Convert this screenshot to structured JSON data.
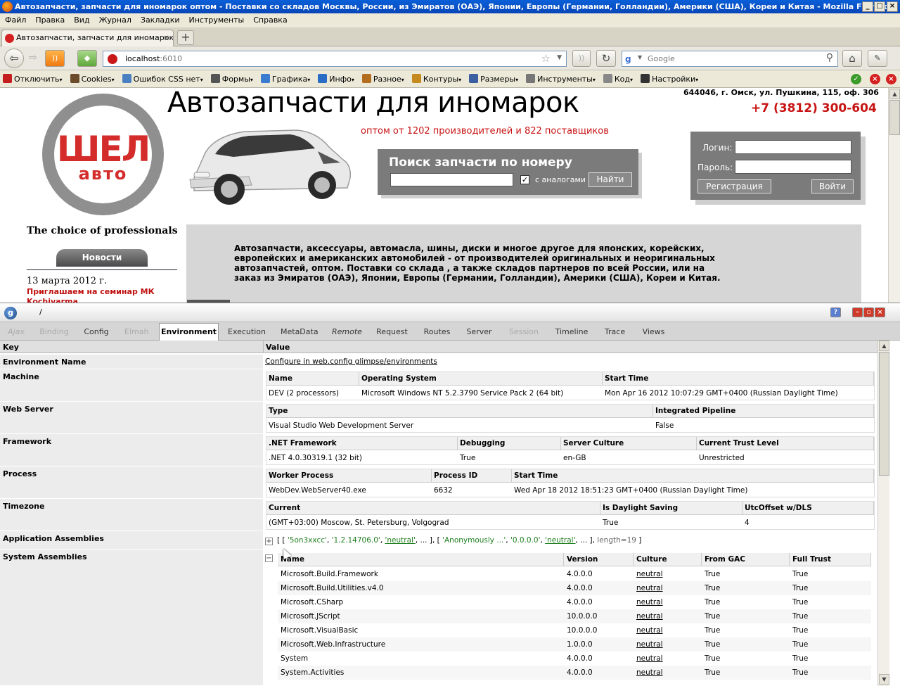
{
  "window": {
    "title": "Автозапчасти, запчасти для иномарок оптом - Поставки со складов Москвы, России, из Эмиратов (ОАЭ), Японии, Европы (Германии, Голландии), Америки (США), Кореи и Китая - Mozilla Firefox"
  },
  "menu": [
    "Файл",
    "Правка",
    "Вид",
    "Журнал",
    "Закладки",
    "Инструменты",
    "Справка"
  ],
  "tab": {
    "title": "Автозапчасти, запчасти для иномарок оп...",
    "close": "×",
    "new": "+"
  },
  "nav": {
    "url_host": "localhost",
    "url_port": ":6010",
    "search_placeholder": "Google"
  },
  "devbar": [
    {
      "label": "Отключить",
      "color": "#c41e1e"
    },
    {
      "label": "Cookies",
      "color": "#6b4b2a"
    },
    {
      "label": "Ошибок CSS нет",
      "color": "#4a7fc1"
    },
    {
      "label": "Формы",
      "color": "#555555"
    },
    {
      "label": "Графика",
      "color": "#3b7bd0"
    },
    {
      "label": "Инфо",
      "color": "#2b6cc4"
    },
    {
      "label": "Разное",
      "color": "#b36d1e"
    },
    {
      "label": "Контуры",
      "color": "#c48a1e"
    },
    {
      "label": "Размеры",
      "color": "#3b5fa0"
    },
    {
      "label": "Инструменты",
      "color": "#777777"
    },
    {
      "label": "Код",
      "color": "#888888"
    },
    {
      "label": "Настройки",
      "color": "#333333"
    }
  ],
  "site": {
    "logo_main": "ШЕЛ",
    "logo_sub": "авто",
    "slogan": "The choice of professionals",
    "news_button": "Новости",
    "news_date": "13 марта 2012 г.",
    "news_link": "Приглашаем на семинар МК Kochivarma",
    "headline": "Автозапчасти для иномарок",
    "subline": "оптом от 1202 производителей и 822 поставщиков",
    "address": "644046, г. Омск, ул. Пушкина, 115, оф. 306",
    "phone": "+7 (3812) 300-604",
    "search_title": "Поиск запчасти по номеру",
    "search_checkbox": "с аналогами",
    "search_button": "Найти",
    "login_label": "Логин:",
    "password_label": "Пароль:",
    "register_button": "Регистрация",
    "login_button": "Войти",
    "promo_text": "Автозапчасти, аксессуары, автомасла, шины, диски и многое другое для японских, корейских, европейских и американских автомобилей - от производителей оригинальных и неоригинальных автозапчастей, оптом. Поставки со склада , а также складов партнеров по всей России, или на заказ из Эмиратов (ОАЭ), Японии, Европы (Германии, Голландии), Америки (США), Кореи и Китая."
  },
  "glimpse": {
    "path": "/",
    "tabs": [
      {
        "label": "Ajax",
        "state": "disabled-italic"
      },
      {
        "label": "Binding",
        "state": "disabled"
      },
      {
        "label": "Config",
        "state": "normal"
      },
      {
        "label": "Elmah",
        "state": "disabled"
      },
      {
        "label": "Environment",
        "state": "active"
      },
      {
        "label": "Execution",
        "state": "normal"
      },
      {
        "label": "MetaData",
        "state": "normal"
      },
      {
        "label": "Remote",
        "state": "italic"
      },
      {
        "label": "Request",
        "state": "normal"
      },
      {
        "label": "Routes",
        "state": "normal"
      },
      {
        "label": "Server",
        "state": "normal"
      },
      {
        "label": "Session",
        "state": "disabled"
      },
      {
        "label": "Timeline",
        "state": "normal"
      },
      {
        "label": "Trace",
        "state": "normal"
      },
      {
        "label": "Views",
        "state": "normal"
      }
    ],
    "col_key": "Key",
    "col_value": "Value",
    "env_name_key": "Environment Name",
    "env_name_value": "Configure in web.config glimpse/environments",
    "machine": {
      "key": "Machine",
      "headers": [
        "Name",
        "Operating System",
        "Start Time"
      ],
      "values": [
        "DEV (2 processors)",
        "Microsoft Windows NT 5.2.3790 Service Pack 2 (64 bit)",
        "Mon Apr 16 2012 10:07:29 GMT+0400 (Russian Daylight Time)"
      ]
    },
    "webserver": {
      "key": "Web Server",
      "headers": [
        "Type",
        "Integrated Pipeline"
      ],
      "values": [
        "Visual Studio Web Development Server",
        "False"
      ]
    },
    "framework": {
      "key": "Framework",
      "headers": [
        ".NET Framework",
        "Debugging",
        "Server Culture",
        "Current Trust Level"
      ],
      "values": [
        ".NET 4.0.30319.1 (32 bit)",
        "True",
        "en-GB",
        "Unrestricted"
      ]
    },
    "process": {
      "key": "Process",
      "headers": [
        "Worker Process",
        "Process ID",
        "Start Time"
      ],
      "values": [
        "WebDev.WebServer40.exe",
        "6632",
        "Wed Apr 18 2012 18:51:23 GMT+0400 (Russian Daylight Time)"
      ]
    },
    "timezone": {
      "key": "Timezone",
      "headers": [
        "Current",
        "Is Daylight Saving",
        "UtcOffset w/DLS"
      ],
      "values": [
        "(GMT+03:00) Moscow, St. Petersburg, Volgograd",
        "True",
        "4"
      ]
    },
    "app_assemblies": {
      "key": "Application Assemblies",
      "expand": "+",
      "a1": "'5on3xxcc'",
      "a2": "'1.2.14706.0'",
      "a3": "'neutral'",
      "b1": "'Anonymously ...'",
      "b2": "'0.0.0.0'",
      "b3": "'neutral'",
      "length": "length=19",
      "open1": "[ [",
      "sep": ",",
      "ellipsis_close": ", ... ],",
      "open2": "[",
      "ellipsis_close2": ", ... ],",
      "close": "]"
    },
    "sys_assemblies": {
      "key": "System Assemblies",
      "collapse": "−",
      "headers": [
        "Name",
        "Version",
        "Culture",
        "From GAC",
        "Full Trust"
      ],
      "rows": [
        [
          "Microsoft.Build.Framework",
          "4.0.0.0",
          "neutral",
          "True",
          "True"
        ],
        [
          "Microsoft.Build.Utilities.v4.0",
          "4.0.0.0",
          "neutral",
          "True",
          "True"
        ],
        [
          "Microsoft.CSharp",
          "4.0.0.0",
          "neutral",
          "True",
          "True"
        ],
        [
          "Microsoft.JScript",
          "10.0.0.0",
          "neutral",
          "True",
          "True"
        ],
        [
          "Microsoft.VisualBasic",
          "10.0.0.0",
          "neutral",
          "True",
          "True"
        ],
        [
          "Microsoft.Web.Infrastructure",
          "1.0.0.0",
          "neutral",
          "True",
          "True"
        ],
        [
          "System",
          "4.0.0.0",
          "neutral",
          "True",
          "True"
        ],
        [
          "System.Activities",
          "4.0.0.0",
          "neutral",
          "True",
          "True"
        ]
      ]
    }
  }
}
